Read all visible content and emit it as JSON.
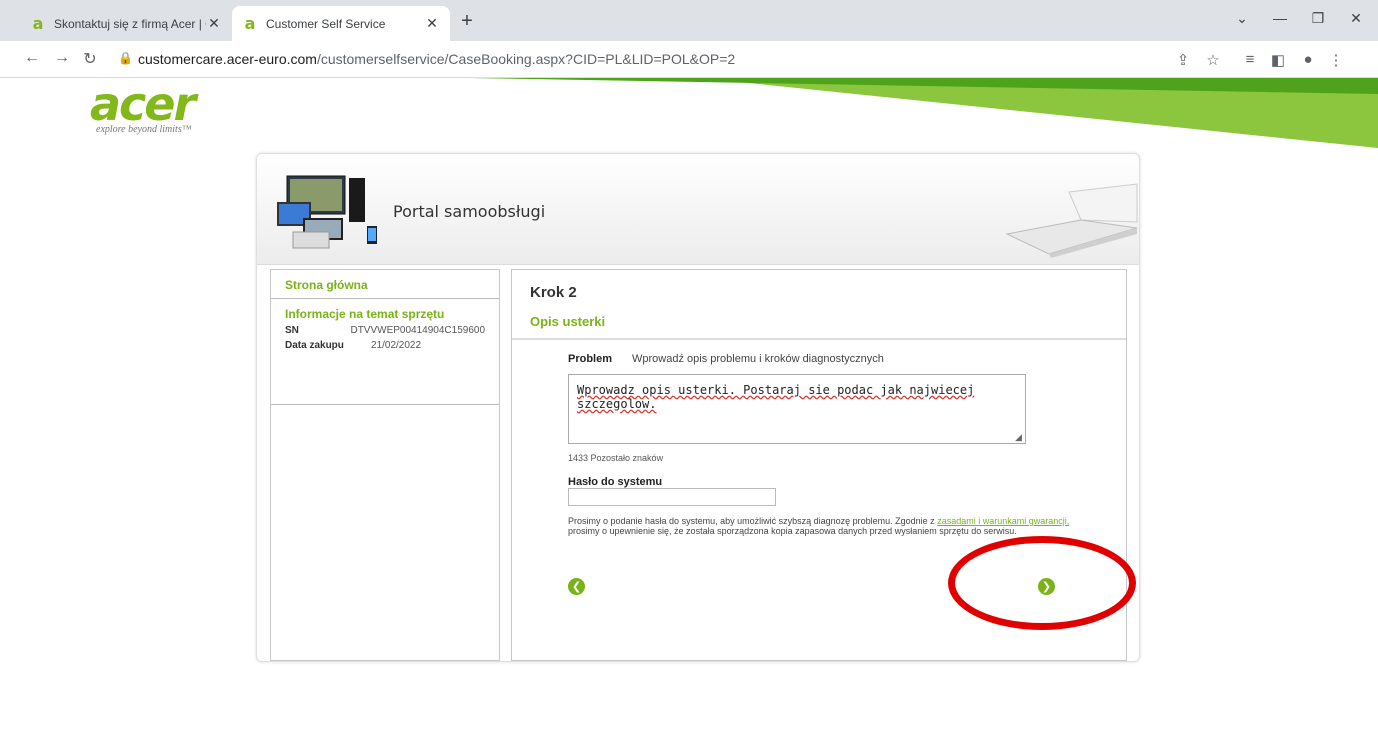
{
  "browser": {
    "tabs": [
      {
        "title": "Skontaktuj się z firmą Acer | Obsł",
        "active": false
      },
      {
        "title": "Customer Self Service",
        "active": true
      }
    ],
    "url_host": "customercare.acer-euro.com",
    "url_path": "/customerselfservice/CaseBooking.aspx?CID=PL&LID=POL&OP=2"
  },
  "logo": {
    "word": "acer",
    "tagline": "explore beyond limits™"
  },
  "header": {
    "portal_title": "Portal samoobsługi"
  },
  "sidebar": {
    "home": "Strona główna",
    "section_title": "Informacje na temat sprzętu",
    "rows": [
      {
        "label": "SN",
        "value": "DTVVWEP00414904C159600"
      },
      {
        "label": "Data zakupu",
        "value": "21/02/2022"
      }
    ]
  },
  "main": {
    "step": "Krok 2",
    "step_title": "Opis usterki",
    "problem_label": "Problem",
    "problem_hint": "Wprowadź opis problemu i kroków diagnostycznych",
    "problem_text": "Wprowadz opis usterki. Postaraj sie podac jak najwiecej szczegolow.",
    "remaining_chars": "1433 Pozostało znaków",
    "password_label": "Hasło do systemu",
    "password_value": "",
    "note_before": "Prosimy o podanie hasła do systemu, aby umożliwić szybszą diagnozę problemu. Zgodnie z ",
    "note_link": "zasadami i warunkami gwarancji,",
    "note_after": " prosimy o upewnienie się, że została sporządzona kopia zapasowa danych przed wysłaniem sprzętu do serwisu."
  },
  "colors": {
    "accent": "#7ab317",
    "annotation": "#e00000"
  }
}
